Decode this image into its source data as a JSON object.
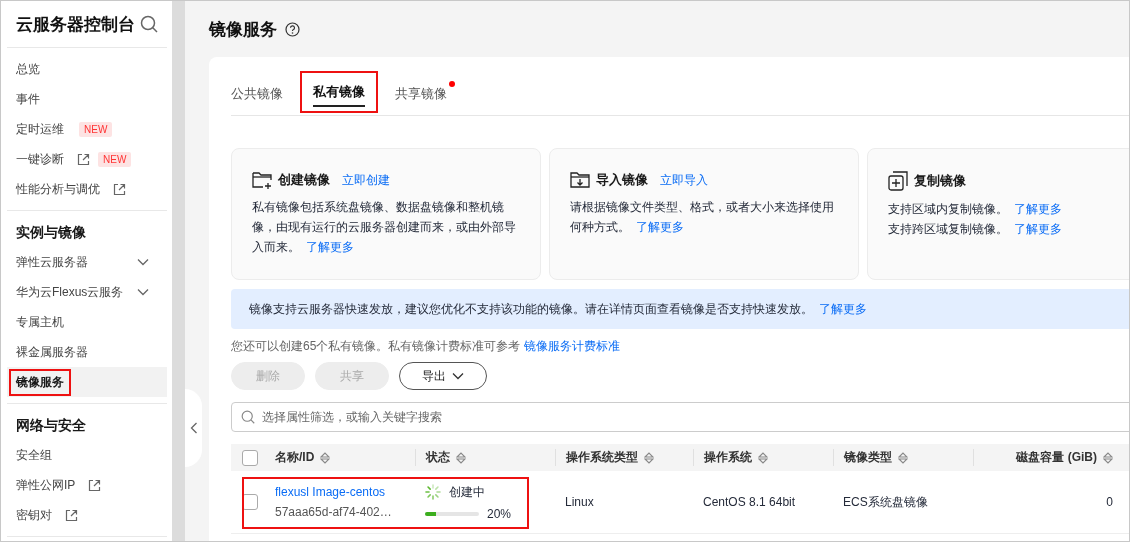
{
  "sidebar": {
    "title": "云服务器控制台",
    "sections": [
      {
        "items": [
          {
            "label": "总览",
            "external": false,
            "expandable": false,
            "selected": false,
            "highlighted": false
          },
          {
            "label": "事件",
            "external": false,
            "expandable": false,
            "selected": false,
            "highlighted": false
          },
          {
            "label": "定时运维",
            "badge": "NEW",
            "external": false,
            "expandable": false,
            "selected": false,
            "highlighted": false
          },
          {
            "label": "一键诊断",
            "badge": "NEW",
            "external": true,
            "expandable": false,
            "selected": false,
            "highlighted": false
          },
          {
            "label": "性能分析与调优",
            "external": true,
            "expandable": false,
            "selected": false,
            "highlighted": false
          }
        ]
      },
      {
        "heading": "实例与镜像",
        "items": [
          {
            "label": "弹性云服务器",
            "external": false,
            "expandable": true,
            "selected": false,
            "highlighted": false
          },
          {
            "label": "华为云Flexus云服务",
            "external": false,
            "expandable": true,
            "selected": false,
            "highlighted": false
          },
          {
            "label": "专属主机",
            "external": false,
            "expandable": false,
            "selected": false,
            "highlighted": false
          },
          {
            "label": "裸金属服务器",
            "external": false,
            "expandable": false,
            "selected": false,
            "highlighted": false
          },
          {
            "label": "镜像服务",
            "external": false,
            "expandable": false,
            "selected": true,
            "highlighted": true
          }
        ]
      },
      {
        "heading": "网络与安全",
        "items": [
          {
            "label": "安全组",
            "external": false,
            "expandable": false,
            "selected": false,
            "highlighted": false
          },
          {
            "label": "弹性公网IP",
            "external": true,
            "expandable": false,
            "selected": false,
            "highlighted": false
          },
          {
            "label": "密钥对",
            "external": true,
            "expandable": false,
            "selected": false,
            "highlighted": false
          }
        ]
      }
    ]
  },
  "header": {
    "title": "镜像服务"
  },
  "tabs": [
    {
      "label": "公共镜像",
      "selected": false,
      "highlighted": false,
      "notification": false
    },
    {
      "label": "私有镜像",
      "selected": true,
      "highlighted": true,
      "notification": false
    },
    {
      "label": "共享镜像",
      "selected": false,
      "highlighted": false,
      "notification": true
    }
  ],
  "feature_cards": [
    {
      "kind": "create",
      "title": "创建镜像",
      "action": "立即创建",
      "paragraphs": [
        {
          "text": "私有镜像包括系统盘镜像、数据盘镜像和整机镜像，由现有运行的云服务器创建而来，或由外部导入而来。",
          "link": "了解更多"
        }
      ]
    },
    {
      "kind": "import",
      "title": "导入镜像",
      "action": "立即导入",
      "paragraphs": [
        {
          "text": "请根据镜像文件类型、格式，或者大小来选择使用何种方式。",
          "link": "了解更多"
        }
      ]
    },
    {
      "kind": "copy",
      "title": "复制镜像",
      "paragraphs": [
        {
          "text": "支持区域内复制镜像。",
          "link": "了解更多"
        },
        {
          "text": "支持跨区域复制镜像。",
          "link": "了解更多"
        }
      ]
    }
  ],
  "banner": {
    "text": "镜像支持云服务器快速发放，建议您优化不支持该功能的镜像。请在详情页面查看镜像是否支持快速发放。",
    "link": "了解更多"
  },
  "quota": {
    "text": "您还可以创建65个私有镜像。私有镜像计费标准可参考",
    "link": "镜像服务计费标准"
  },
  "buttons": [
    {
      "label": "删除",
      "disabled": true,
      "dropdown": false
    },
    {
      "label": "共享",
      "disabled": true,
      "dropdown": false
    },
    {
      "label": "导出",
      "disabled": false,
      "dropdown": true
    }
  ],
  "search": {
    "placeholder": "选择属性筛选，或输入关键字搜索"
  },
  "table": {
    "select_all_checked": false,
    "columns": [
      {
        "label": "名称/ID",
        "sortable": true
      },
      {
        "label": "状态",
        "sortable": true
      },
      {
        "label": "操作系统类型",
        "sortable": true
      },
      {
        "label": "操作系统",
        "sortable": true
      },
      {
        "label": "镜像类型",
        "sortable": true
      },
      {
        "label": "磁盘容量 (GiB)",
        "sortable": true
      }
    ],
    "rows": [
      {
        "checked": false,
        "highlighted": true,
        "name": "flexusl Image-centos",
        "id": "57aaa65d-af74-402…",
        "status": "创建中",
        "progress": {
          "level": 0.2,
          "reading": "20%"
        },
        "os_type": "Linux",
        "os": "CentOS 8.1 64bit",
        "image_type": "ECS系统盘镜像",
        "disk": "0"
      }
    ]
  }
}
